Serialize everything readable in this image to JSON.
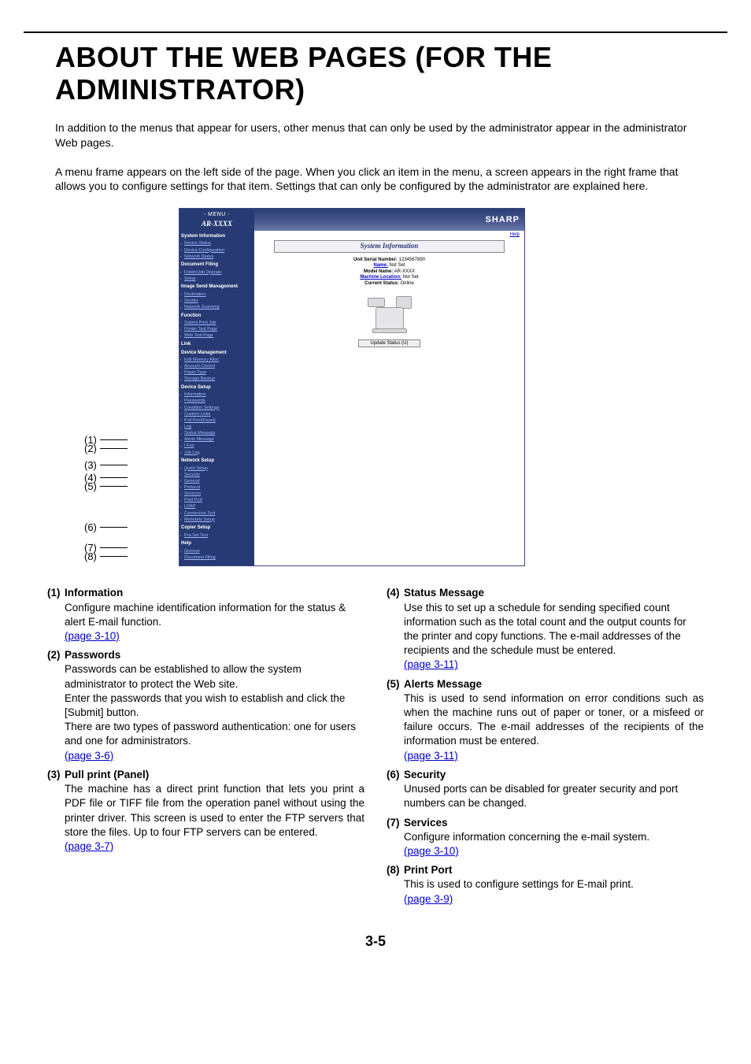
{
  "title": "ABOUT THE WEB PAGES (FOR THE ADMINISTRATOR)",
  "intro1": "In addition to the menus that appear for users, other menus that can only be used by the administrator appear in the administrator Web pages.",
  "intro2": "A menu frame appears on the left side of the page. When you click an item in the menu, a screen appears in the right frame that allows you to configure settings for that item. Settings that can only be configured by the administrator are explained here.",
  "page_number": "3-5",
  "shot": {
    "menu_label": "- MENU -",
    "model": "AR-XXXX",
    "brand": "SHARP",
    "help": "Help",
    "content_header": "System Information",
    "update_btn": "Update Status (U)",
    "kv": {
      "serial_k": "Unit Serial Number:",
      "serial_v": "1234567890",
      "name_k": "Name:",
      "name_v": "Not Set",
      "modelname_k": "Model Name:",
      "modelname_v": "AR-XXXX",
      "loc_k": "Machine Location:",
      "loc_v": "Not Set",
      "status_k": "Current Status:",
      "status_v": "Online"
    },
    "sections": {
      "sysinfo": {
        "title": "System Information",
        "items": [
          "Device Status",
          "Device Configuration",
          "Network Status"
        ]
      },
      "docfiling": {
        "title": "Document Filing",
        "items": [
          "Folder/Job Operate",
          "Setup"
        ]
      },
      "imgsend": {
        "title": "Image Send Management",
        "items": [
          "Destination",
          "Sender",
          "Network Scanning"
        ]
      },
      "function": {
        "title": "Function",
        "items": [
          "Submit Print Job",
          "Printer Test Page",
          "Web Test Page"
        ]
      },
      "link": {
        "title": "Link",
        "items": []
      },
      "devmgmt": {
        "title": "Device Management",
        "items": [
          "Edit Memory Alloc",
          "Account Control",
          "Paper Type",
          "Storage Backup"
        ]
      },
      "devsetup": {
        "title": "Device Setup",
        "items": [
          "Information",
          "Passwords",
          "Condition Settings",
          "Custom Links",
          "Pull Print(Panel)",
          "Log",
          "Status Message",
          "Alerts Message",
          "I-Fax",
          "Job Log"
        ]
      },
      "netsetup": {
        "title": "Network Setup",
        "items": [
          "Quick Setup",
          "Security",
          "General",
          "Protocol",
          "Services",
          "Print Port",
          "LDAP",
          "Connection Test",
          "Metadata Setup"
        ]
      },
      "copsetup": {
        "title": "Copier Setup",
        "items": [
          "Pre-Set Text"
        ]
      },
      "help": {
        "title": "Help",
        "items": [
          "General",
          "Document Filing"
        ]
      }
    }
  },
  "callouts": {
    "c1": "(1)",
    "c2": "(2)",
    "c3": "(3)",
    "c4": "(4)",
    "c5": "(5)",
    "c6": "(6)",
    "c7": "(7)",
    "c8": "(8)"
  },
  "items": {
    "i1": {
      "num": "(1)",
      "title": "Information",
      "body": "Configure machine identification information for the status & alert E-mail function.",
      "page": "(page 3-10)"
    },
    "i2": {
      "num": "(2)",
      "title": "Passwords",
      "b1": "Passwords can be established to allow the system administrator to protect the Web site.",
      "b2": "Enter the passwords that you wish to establish and click the [Submit] button.",
      "b3": "There are two types of password authentication: one for users and one for administrators.",
      "page": "(page 3-6)"
    },
    "i3": {
      "num": "(3)",
      "title": "Pull print (Panel)",
      "body": "The machine has a direct print function that lets you print a PDF file or TIFF file from the operation panel without using the printer driver. This screen is used to enter the FTP servers that store the files. Up to four FTP servers can be entered.",
      "page": "(page 3-7)"
    },
    "i4": {
      "num": "(4)",
      "title": "Status Message",
      "body": "Use this to set up a schedule for sending specified count information such as the total count and the output counts for the printer and copy functions. The e-mail addresses of the recipients and the schedule must be entered.",
      "page": "(page 3-11)"
    },
    "i5": {
      "num": "(5)",
      "title": "Alerts Message",
      "body": "This is used to send information on error conditions such as when the machine runs out of paper or toner, or a misfeed or failure occurs. The e-mail addresses of the recipients of the information must be entered.",
      "page": "(page 3-11)"
    },
    "i6": {
      "num": "(6)",
      "title": "Security",
      "body": "Unused ports can be disabled for greater security and port numbers can be changed."
    },
    "i7": {
      "num": "(7)",
      "title": "Services",
      "body": "Configure information concerning the e-mail system.",
      "page": "(page 3-10)"
    },
    "i8": {
      "num": "(8)",
      "title": "Print Port",
      "body": "This is used to configure settings for E-mail print.",
      "page": "(page 3-9)"
    }
  }
}
